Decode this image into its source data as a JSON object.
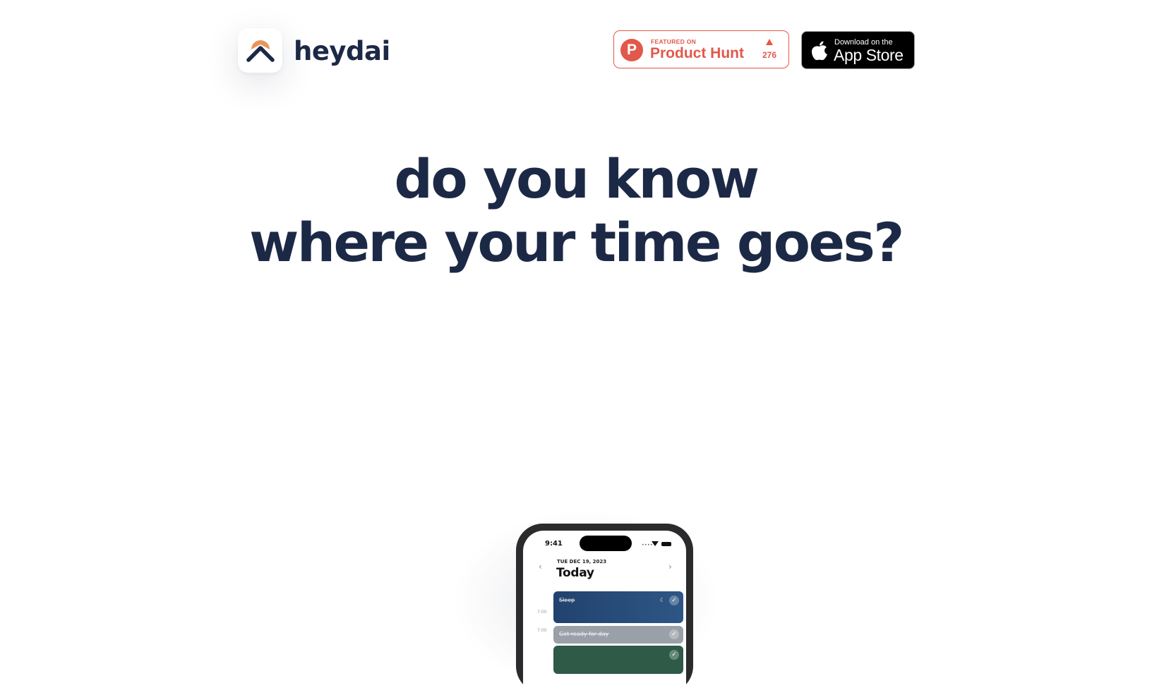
{
  "header": {
    "brand_name": "heydai",
    "logo_colors": {
      "arc": "#e9955a",
      "chevron": "#1c2946"
    },
    "product_hunt": {
      "featured_label": "FEATURED ON",
      "name": "Product Hunt",
      "count": "276",
      "icon_letter": "P",
      "color": "#e2584a"
    },
    "app_store": {
      "small_label": "Download on the",
      "big_label": "App Store",
      "icon": "apple-icon"
    }
  },
  "hero": {
    "line1": "do you know",
    "line2": "where your time goes?"
  },
  "phone": {
    "status_time": "9:41",
    "status_dots": "••••",
    "date_label": "TUE DEC 19, 2023",
    "title": "Today",
    "nav_prev": "‹",
    "nav_next": "›",
    "times": [
      "7:00",
      "7:00"
    ],
    "events": [
      {
        "title": "Sleep",
        "color": "#22426e"
      },
      {
        "title": "Get ready for day",
        "color": "#9aa0a8"
      },
      {
        "title": "",
        "color": "#2f5a48"
      }
    ],
    "check_glyph": "✓",
    "moon_glyph": "☾"
  }
}
